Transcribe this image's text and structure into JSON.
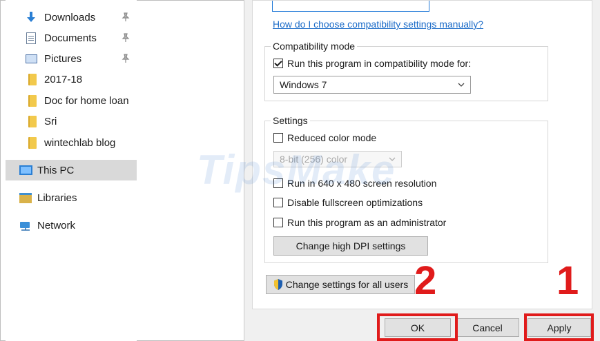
{
  "sidebar": {
    "items": [
      {
        "label": "Downloads",
        "icon": "download-arrow-icon",
        "pinned": true
      },
      {
        "label": "Documents",
        "icon": "document-icon",
        "pinned": true
      },
      {
        "label": "Pictures",
        "icon": "pictures-icon",
        "pinned": true
      },
      {
        "label": "2017-18",
        "icon": "folder-icon",
        "pinned": false
      },
      {
        "label": "Doc for home loan",
        "icon": "folder-icon",
        "pinned": false
      },
      {
        "label": "Sri",
        "icon": "folder-icon",
        "pinned": false
      },
      {
        "label": "wintechlab blog",
        "icon": "folder-icon",
        "pinned": false
      },
      {
        "label": "This PC",
        "icon": "computer-icon",
        "selected": true
      },
      {
        "label": "Libraries",
        "icon": "libraries-icon"
      },
      {
        "label": "Network",
        "icon": "network-icon"
      }
    ]
  },
  "dialog": {
    "help_link": "How do I choose compatibility settings manually?",
    "compat_group": {
      "title": "Compatibility mode",
      "run_in_compat_label": "Run this program in compatibility mode for:",
      "run_in_compat_checked": true,
      "os_select_value": "Windows 7"
    },
    "settings_group": {
      "title": "Settings",
      "reduced_color_label": "Reduced color mode",
      "reduced_color_checked": false,
      "color_select_value": "8-bit (256) color",
      "res_640_label": "Run in 640 x 480 screen resolution",
      "res_640_checked": false,
      "disable_fullscreen_label": "Disable fullscreen optimizations",
      "disable_fullscreen_checked": false,
      "run_as_admin_label": "Run this program as an administrator",
      "run_as_admin_checked": false,
      "high_dpi_button": "Change high DPI settings"
    },
    "all_users_button": "Change settings for all users",
    "footer": {
      "ok_label": "OK",
      "cancel_label": "Cancel",
      "apply_label": "Apply"
    }
  },
  "annotations": {
    "step_ok": "2",
    "step_apply": "1",
    "highlight_color": "#e01b1b"
  },
  "watermark": "TipsMake"
}
